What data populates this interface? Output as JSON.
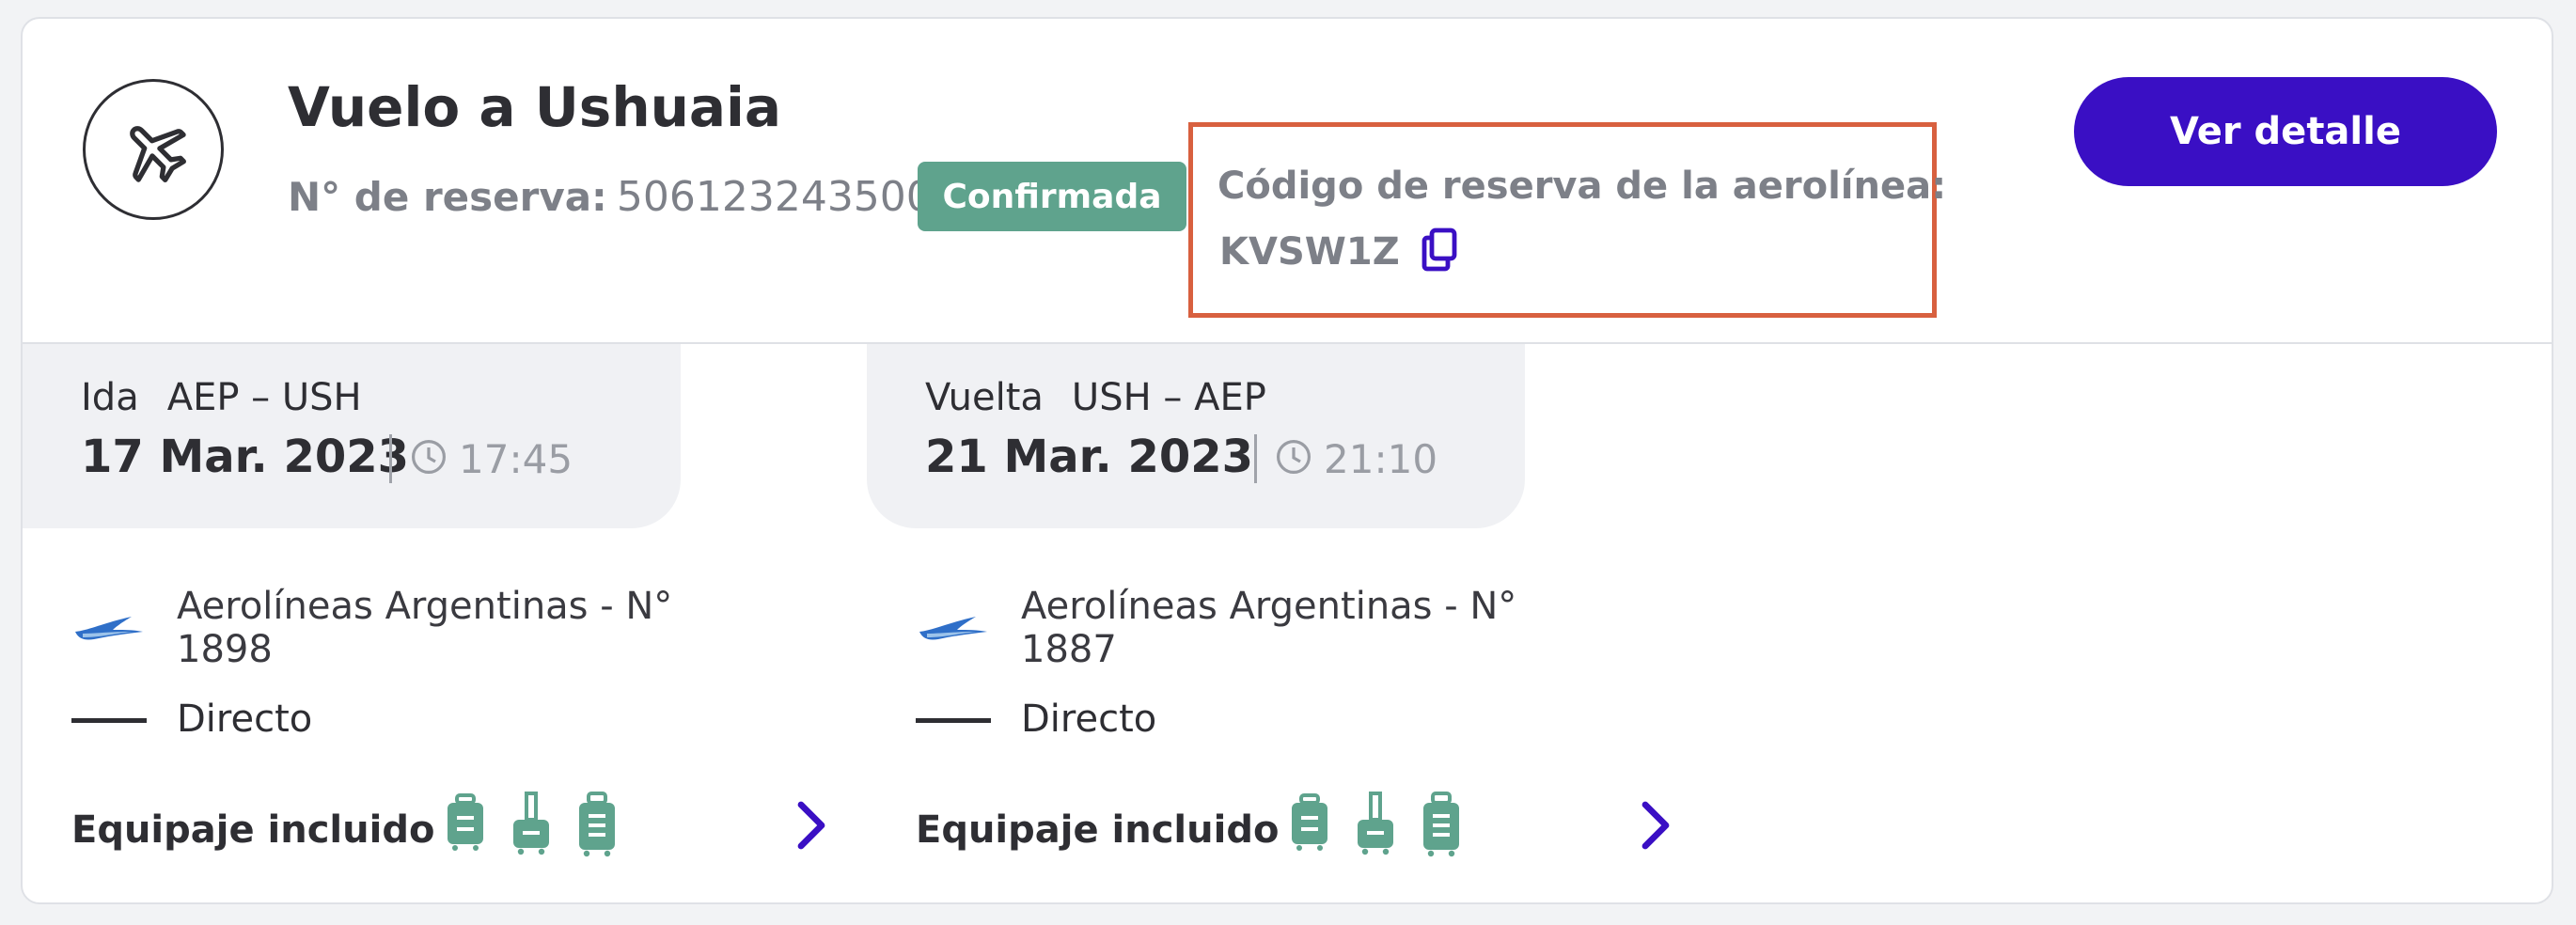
{
  "header": {
    "title": "Vuelo a Ushuaia",
    "reserva_label": "N° de reserva:",
    "reserva_number": "506123243500",
    "status_badge": "Confirmada",
    "airline_code_label": "Código de reserva de la aerolínea:",
    "airline_code": "KVSW1Z",
    "detail_button": "Ver detalle"
  },
  "legs": [
    {
      "type": "Ida",
      "route": "AEP – USH",
      "date": "17 Mar. 2023",
      "time": "17:45",
      "airline": "Aerolíneas Argentinas - N° 1898",
      "stops": "Directo",
      "baggage_label": "Equipaje incluido"
    },
    {
      "type": "Vuelta",
      "route": "USH – AEP",
      "date": "21 Mar. 2023",
      "time": "21:10",
      "airline": "Aerolíneas Argentinas - N° 1887",
      "stops": "Directo",
      "baggage_label": "Equipaje incluido"
    }
  ],
  "icons": {
    "plane": "airplane-icon",
    "copy": "copy-icon",
    "clock": "clock-icon",
    "airline_logo": "aerolineas-argentinas-logo",
    "baggage": [
      "personal-item-icon",
      "carry-on-icon",
      "checked-bag-icon"
    ],
    "chevron": "chevron-right-icon"
  },
  "colors": {
    "primary": "#3a0fc4",
    "confirmed": "#5fa38d",
    "highlight_border": "#d8603f",
    "baggage": "#5fa38d"
  }
}
